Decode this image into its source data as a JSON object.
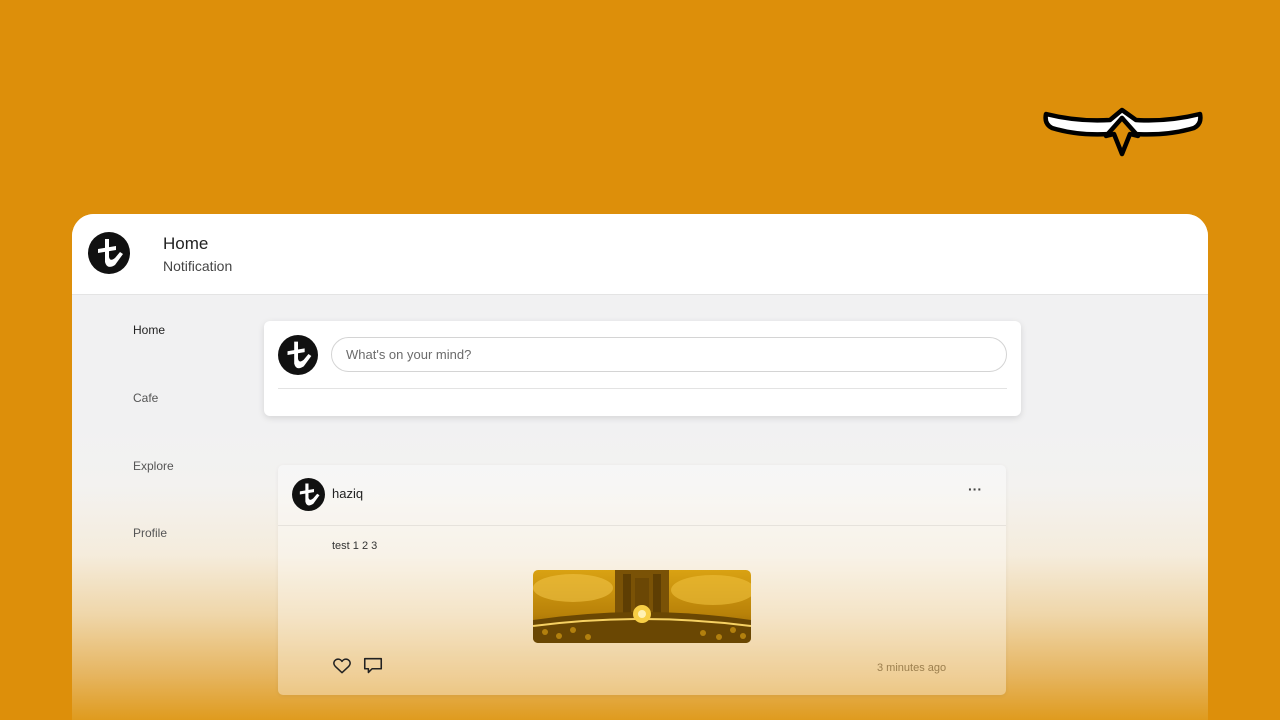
{
  "header": {
    "home_label": "Home",
    "notification_label": "Notification"
  },
  "sidebar": {
    "items": [
      {
        "label": "Home",
        "active": true
      },
      {
        "label": "Cafe",
        "active": false
      },
      {
        "label": "Explore",
        "active": false
      },
      {
        "label": "Profile",
        "active": false
      }
    ]
  },
  "composer": {
    "placeholder": "What's on your mind?",
    "value": ""
  },
  "posts": [
    {
      "username": "haziq",
      "more_icon": "more-horizontal-icon",
      "text": "test 1 2 3",
      "timestamp": "3 minutes ago",
      "actions": [
        "heart-icon",
        "comment-icon"
      ]
    }
  ],
  "colors": {
    "background": "#DD8F0A",
    "window": "#FFFFFF",
    "content_bg": "#F1F1F2",
    "text_primary": "#222222",
    "text_secondary": "#555555"
  }
}
